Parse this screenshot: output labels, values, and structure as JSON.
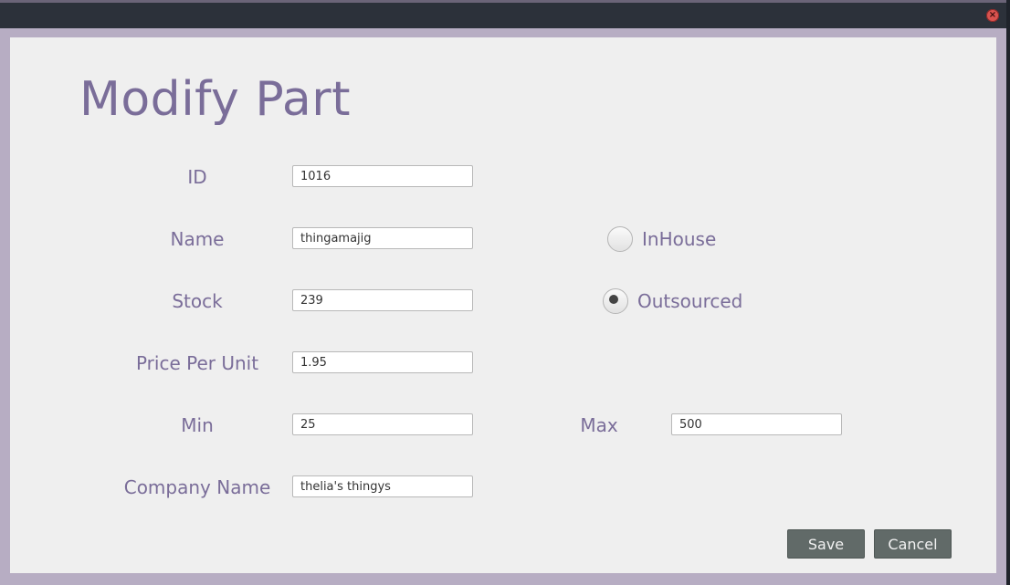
{
  "window": {
    "close_icon": "×"
  },
  "page": {
    "title": "Modify Part"
  },
  "form": {
    "id": {
      "label": "ID",
      "value": "1016"
    },
    "name": {
      "label": "Name",
      "value": "thingamajig"
    },
    "stock": {
      "label": "Stock",
      "value": "239"
    },
    "price": {
      "label": "Price Per Unit",
      "value": "1.95"
    },
    "min": {
      "label": "Min",
      "value": "25"
    },
    "max": {
      "label": "Max",
      "value": "500"
    },
    "company": {
      "label": "Company Name",
      "value": "thelia's thingys"
    }
  },
  "source": {
    "inhouse_label": "InHouse",
    "outsourced_label": "Outsourced",
    "selected": "Outsourced"
  },
  "buttons": {
    "save": "Save",
    "cancel": "Cancel"
  },
  "colors": {
    "accent": "#7a6d99",
    "button_bg": "#616a68",
    "panel_bg": "#efefef"
  }
}
